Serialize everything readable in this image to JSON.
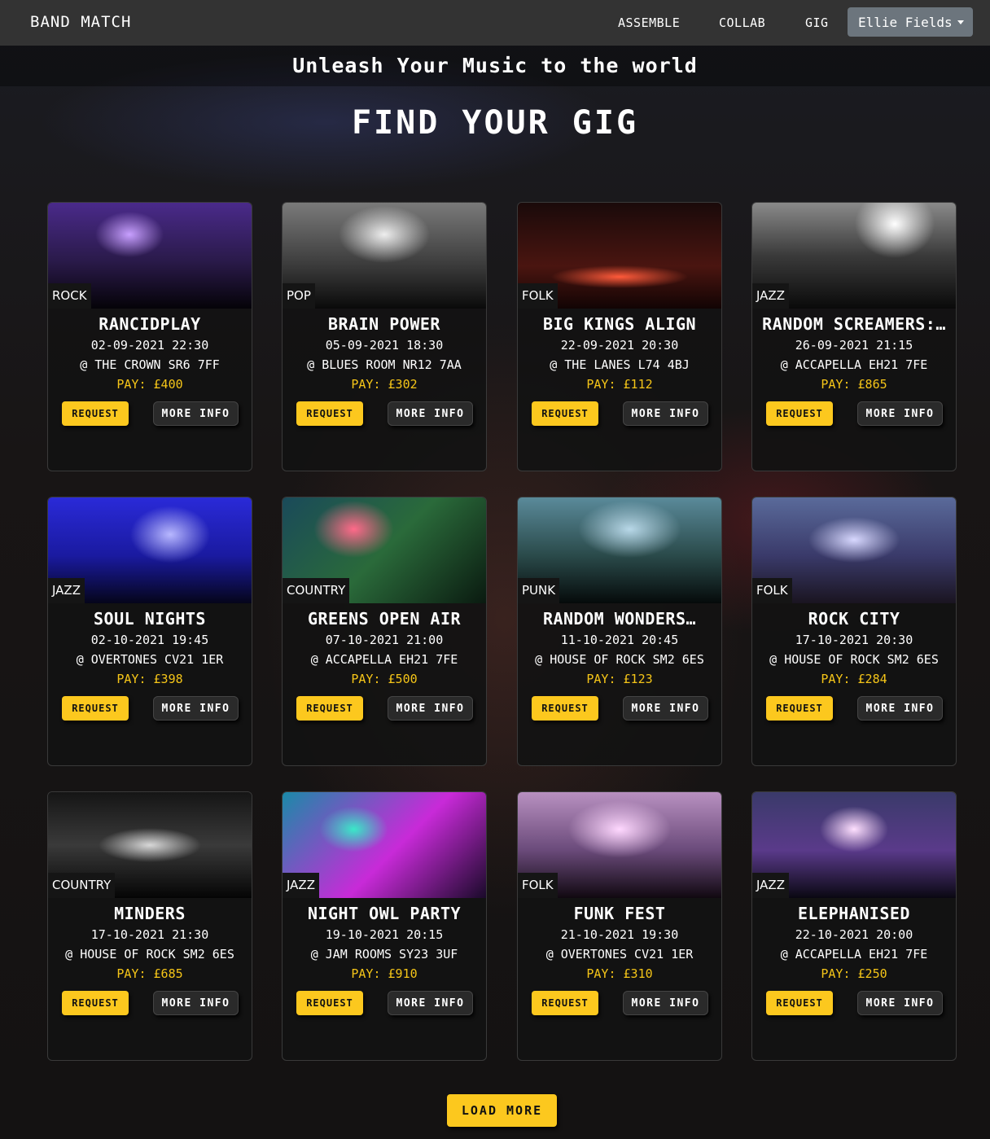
{
  "nav": {
    "brand": "BAND MATCH",
    "links": [
      "ASSEMBLE",
      "COLLAB",
      "GIG"
    ],
    "user": "Ellie Fields"
  },
  "hero": {
    "tagline": "Unleash Your Music to the world",
    "title": "FIND YOUR GIG"
  },
  "labels": {
    "request": "REQUEST",
    "more_info": "MORE INFO",
    "load_more": "LOAD MORE"
  },
  "gigs": [
    {
      "genre": "ROCK",
      "name": "RANCIDPLAY",
      "date": "02-09-2021 22:30",
      "venue": "@ THE CROWN SR6 7FF",
      "pay": "PAY: £400"
    },
    {
      "genre": "POP",
      "name": "BRAIN POWER",
      "date": "05-09-2021 18:30",
      "venue": "@ BLUES ROOM NR12 7AA",
      "pay": "PAY: £302"
    },
    {
      "genre": "FOLK",
      "name": "BIG KINGS ALIGN",
      "date": "22-09-2021 20:30",
      "venue": "@ THE LANES L74 4BJ",
      "pay": "PAY: £112"
    },
    {
      "genre": "JAZZ",
      "name": "RANDOM SCREAMERS:…",
      "date": "26-09-2021 21:15",
      "venue": "@ ACCAPELLA EH21 7FE",
      "pay": "PAY: £865"
    },
    {
      "genre": "JAZZ",
      "name": "SOUL NIGHTS",
      "date": "02-10-2021 19:45",
      "venue": "@ OVERTONES CV21 1ER",
      "pay": "PAY: £398"
    },
    {
      "genre": "COUNTRY",
      "name": "GREENS OPEN AIR",
      "date": "07-10-2021 21:00",
      "venue": "@ ACCAPELLA EH21 7FE",
      "pay": "PAY: £500"
    },
    {
      "genre": "PUNK",
      "name": "RANDOM WONDERS…",
      "date": "11-10-2021 20:45",
      "venue": "@ HOUSE OF ROCK SM2 6ES",
      "pay": "PAY: £123"
    },
    {
      "genre": "FOLK",
      "name": "ROCK CITY",
      "date": "17-10-2021 20:30",
      "venue": "@ HOUSE OF ROCK SM2 6ES",
      "pay": "PAY: £284"
    },
    {
      "genre": "COUNTRY",
      "name": "MINDERS",
      "date": "17-10-2021 21:30",
      "venue": "@ HOUSE OF ROCK SM2 6ES",
      "pay": "PAY: £685"
    },
    {
      "genre": "JAZZ",
      "name": "NIGHT OWL PARTY",
      "date": "19-10-2021 20:15",
      "venue": "@ JAM ROOMS SY23 3UF",
      "pay": "PAY: £910"
    },
    {
      "genre": "FOLK",
      "name": "FUNK FEST",
      "date": "21-10-2021 19:30",
      "venue": "@ OVERTONES CV21 1ER",
      "pay": "PAY: £310"
    },
    {
      "genre": "JAZZ",
      "name": "ELEPHANISED",
      "date": "22-10-2021 20:00",
      "venue": "@ ACCAPELLA EH21 7FE",
      "pay": "PAY: £250"
    }
  ],
  "colors": {
    "accent": "#fcc81e",
    "pay_text": "#f5c518",
    "nav_bg": "#333333",
    "user_button": "#6c757d"
  }
}
